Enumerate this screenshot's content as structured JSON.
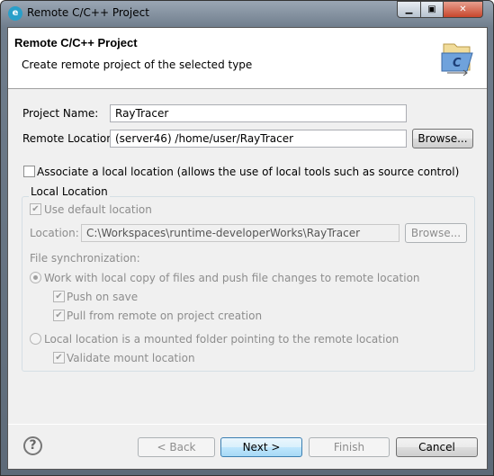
{
  "window": {
    "title": "Remote C/C++ Project",
    "app_icon": "eclipse-cdt-icon",
    "controls": [
      "minimize",
      "maximize",
      "close"
    ]
  },
  "header": {
    "title": "Remote C/C++ Project",
    "description": "Create remote project of the selected type",
    "banner_icon": "c-project-folder-icon"
  },
  "form": {
    "project_name_label": "Project Name:",
    "project_name_value": "RayTracer",
    "remote_location_label": "Remote Location:",
    "remote_location_value": "(server46) /home/user/RayTracer",
    "browse_label": "Browse...",
    "associate_label": "Associate a local location (allows the use of local tools such as source control)",
    "associate_checked": false
  },
  "local": {
    "group_title": "Local Location",
    "use_default_label": "Use default location",
    "use_default_checked": true,
    "location_label": "Location:",
    "location_value": "C:\\Workspaces\\runtime-developerWorks\\RayTracer",
    "browse_label": "Browse...",
    "sync_label": "File synchronization:",
    "radio_work_local": "Work with local copy of files and push file changes to remote location",
    "push_on_save": "Push on save",
    "pull_on_create": "Pull from remote on project creation",
    "radio_mounted": "Local location is a mounted folder pointing to the remote location",
    "validate_mount": "Validate mount location",
    "selected_sync": "work-local"
  },
  "footer": {
    "back": "< Back",
    "next": "Next >",
    "finish": "Finish",
    "cancel": "Cancel",
    "help_icon": "help-icon"
  }
}
